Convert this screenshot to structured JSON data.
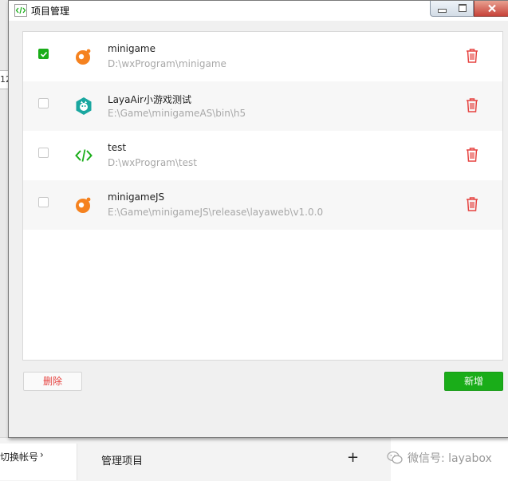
{
  "window": {
    "title": "项目管理"
  },
  "projects": [
    {
      "name": "minigame",
      "path": "D:\\wxProgram\\minigame",
      "checked": true,
      "icon": "orange-game-icon"
    },
    {
      "name": "LayaAir小游戏测试",
      "path": "E:\\Game\\minigameAS\\bin\\h5",
      "checked": false,
      "icon": "layaair-icon"
    },
    {
      "name": "test",
      "path": "D:\\wxProgram\\test",
      "checked": false,
      "icon": "code-icon"
    },
    {
      "name": "minigameJS",
      "path": "E:\\Game\\minigameJS\\release\\layaweb\\v1.0.0",
      "checked": false,
      "icon": "orange-game-icon"
    }
  ],
  "footer": {
    "delete_label": "删除",
    "add_label": "新增"
  },
  "background": {
    "account_label": "切换帐号",
    "fragment_text": "12",
    "manage_label": "管理项目",
    "plus_label": "+",
    "watermark": "微信号: layabox"
  },
  "colors": {
    "accent_green": "#1aad19",
    "delete_red": "#e64340",
    "orange": "#f5821f",
    "teal": "#1aa7a0"
  }
}
